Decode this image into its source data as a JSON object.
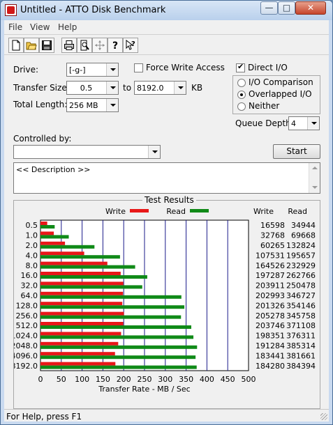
{
  "window": {
    "title": "Untitled - ATTO Disk Benchmark",
    "min": "—",
    "max": "□",
    "close": "✕"
  },
  "menu": [
    "File",
    "View",
    "Help"
  ],
  "toolbar": [
    "new-icon",
    "open-icon",
    "save-icon",
    "print-icon",
    "print-preview-icon",
    "move-icon",
    "help-icon",
    "context-help-icon"
  ],
  "form": {
    "drive_label": "Drive:",
    "drive_value": "[-g-]",
    "force_write_label": "Force Write Access",
    "force_write_checked": false,
    "direct_io_label": "Direct I/O",
    "direct_io_checked": true,
    "transfer_size_label": "Transfer Size:",
    "transfer_from": "0.5",
    "to_label": "to",
    "transfer_to": "8192.0",
    "kb_label": "KB",
    "total_length_label": "Total Length:",
    "total_length_value": "256 MB",
    "io_options": [
      "I/O Comparison",
      "Overlapped I/O",
      "Neither"
    ],
    "io_selected": "Overlapped I/O",
    "queue_depth_label": "Queue Depth:",
    "queue_depth_value": "4",
    "controlled_by_label": "Controlled by:",
    "controlled_by_value": "",
    "start_label": "Start",
    "description": "<< Description >>"
  },
  "results": {
    "title": "Test Results",
    "legend_write": "Write",
    "legend_read": "Read",
    "col_write": "Write",
    "col_read": "Read",
    "rows": [
      {
        "size": "0.5",
        "write": "16598",
        "read": "34944"
      },
      {
        "size": "1.0",
        "write": "32768",
        "read": "69668"
      },
      {
        "size": "2.0",
        "write": "60265",
        "read": "132824"
      },
      {
        "size": "4.0",
        "write": "107531",
        "read": "195657"
      },
      {
        "size": "8.0",
        "write": "164526",
        "read": "232929"
      },
      {
        "size": "16.0",
        "write": "197287",
        "read": "262766"
      },
      {
        "size": "32.0",
        "write": "203911",
        "read": "250478"
      },
      {
        "size": "64.0",
        "write": "202993",
        "read": "346727"
      },
      {
        "size": "128.0",
        "write": "201326",
        "read": "354146"
      },
      {
        "size": "256.0",
        "write": "205278",
        "read": "345758"
      },
      {
        "size": "512.0",
        "write": "203746",
        "read": "371108"
      },
      {
        "size": "1024.0",
        "write": "198351",
        "read": "376311"
      },
      {
        "size": "2048.0",
        "write": "191284",
        "read": "385314"
      },
      {
        "size": "4096.0",
        "write": "183441",
        "read": "381661"
      },
      {
        "size": "8192.0",
        "write": "184280",
        "read": "384394"
      }
    ]
  },
  "chart_data": {
    "type": "bar",
    "orientation": "horizontal",
    "categories": [
      "0.5",
      "1.0",
      "2.0",
      "4.0",
      "8.0",
      "16.0",
      "32.0",
      "64.0",
      "128.0",
      "256.0",
      "512.0",
      "1024.0",
      "2048.0",
      "4096.0",
      "8192.0"
    ],
    "series": [
      {
        "name": "Write",
        "color": "#e81818",
        "values": [
          16.2,
          32.0,
          58.9,
          105.0,
          160.7,
          192.7,
          199.1,
          198.2,
          196.6,
          200.5,
          199.0,
          193.7,
          186.8,
          179.1,
          180.0
        ]
      },
      {
        "name": "Read",
        "color": "#108a18",
        "values": [
          34.1,
          68.0,
          129.7,
          191.1,
          227.5,
          256.6,
          244.6,
          338.6,
          345.8,
          337.7,
          362.4,
          367.5,
          376.3,
          372.7,
          375.4
        ]
      }
    ],
    "xlabel": "Transfer Rate - MB / Sec",
    "xticks": [
      "0",
      "50",
      "100",
      "150",
      "200",
      "250",
      "300",
      "350",
      "400",
      "450",
      "500"
    ],
    "xlim": [
      0,
      500
    ],
    "grid": true,
    "legend": "top"
  },
  "status": "For Help, press F1"
}
